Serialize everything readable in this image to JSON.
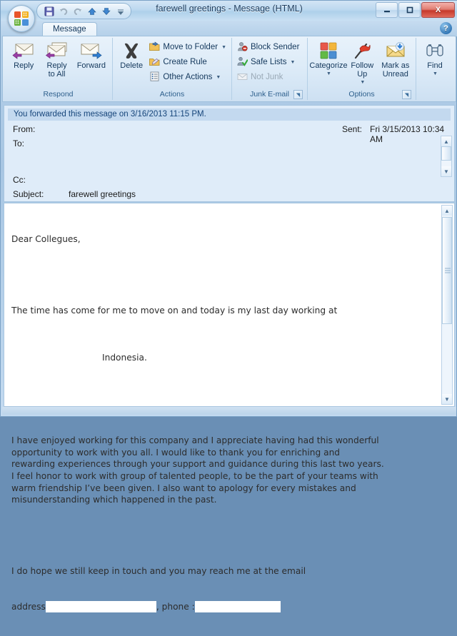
{
  "window": {
    "title": "farewell greetings  - Message (HTML)",
    "minimize_label": "–",
    "maximize_label": "□",
    "close_label": "X"
  },
  "quick_access": {
    "save_icon": "save-icon",
    "undo_icon": "undo-icon",
    "redo_icon": "redo-icon",
    "previous_icon": "previous-item-icon",
    "next_icon": "next-item-icon",
    "customize_icon": "customize-quick-access-icon"
  },
  "tabs": [
    {
      "label": "Message",
      "selected": true
    }
  ],
  "help": {
    "label": "?"
  },
  "ribbon": {
    "groups": [
      {
        "name": "Respond",
        "label": "Respond",
        "buttons": [
          {
            "label": "Reply",
            "icon": "reply-icon"
          },
          {
            "label": "Reply\nto All",
            "icon": "reply-all-icon"
          },
          {
            "label": "Forward",
            "icon": "forward-icon"
          }
        ]
      },
      {
        "name": "Actions",
        "label": "Actions",
        "big": {
          "label": "Delete",
          "icon": "delete-x-icon"
        },
        "items": [
          {
            "label": "Move to Folder",
            "icon": "move-to-folder-icon",
            "caret": true,
            "disabled": false
          },
          {
            "label": "Create Rule",
            "icon": "create-rule-icon",
            "caret": false,
            "disabled": false
          },
          {
            "label": "Other Actions",
            "icon": "other-actions-icon",
            "caret": true,
            "disabled": false
          }
        ]
      },
      {
        "name": "Junk E-mail",
        "label": "Junk E-mail",
        "items": [
          {
            "label": "Block Sender",
            "icon": "block-sender-icon",
            "caret": false,
            "disabled": false
          },
          {
            "label": "Safe Lists",
            "icon": "safe-lists-icon",
            "caret": true,
            "disabled": false
          },
          {
            "label": "Not Junk",
            "icon": "not-junk-icon",
            "caret": false,
            "disabled": true
          }
        ],
        "has_launcher": true
      },
      {
        "name": "Options",
        "label": "Options",
        "buttons": [
          {
            "label": "Categorize",
            "icon": "categorize-icon",
            "caret": true
          },
          {
            "label": "Follow\nUp",
            "icon": "follow-up-flag-icon",
            "caret": true
          },
          {
            "label": "Mark as\nUnread",
            "icon": "mark-as-unread-icon",
            "caret": false
          }
        ],
        "has_launcher": true
      },
      {
        "name": "Find",
        "label": "",
        "buttons": [
          {
            "label": "Find",
            "icon": "find-binoculars-icon",
            "caret": true
          }
        ]
      }
    ]
  },
  "message_header": {
    "info_bar": "You forwarded this message on 3/16/2013 11:15 PM.",
    "from_label": "From:",
    "from_value": "",
    "to_label": "To:",
    "to_value": "",
    "cc_label": "Cc:",
    "cc_value": "",
    "subject_label": "Subject:",
    "subject_value": "farewell greetings",
    "sent_label": "Sent:",
    "sent_value": "Fri 3/15/2013 10:34 AM"
  },
  "body": {
    "line_1": "Dear Collegues,",
    "line_2": "",
    "line_3": "The time has come for me to move on and today is my last day working at",
    "line_4_redacted_prefix": "                    ",
    "line_4": "Indonesia.",
    "line_5": "",
    "paragraph_2": "I have enjoyed working for this company and I appreciate having had this wonderful\nopportunity to work with you all. I would like to thank you for enriching and\nrewarding experiences through your support and guidance during this last two years.\nI feel honor to work with group of talented people, to be the part of your teams with\nwarm friendship I’ve been given. I also want to apology for every mistakes and\nmisunderstanding which happened in the past.",
    "paragraph_3_line_1": "I do hope we still keep in touch and you may reach me at the email",
    "paragraph_3_line_2_a": "address",
    "paragraph_3_line_2_b": ", phone :"
  },
  "colors": {
    "accent": "#2d5f8c",
    "titlebar": "#bcd8ef",
    "header_pane": "#dfecf9",
    "info_bar": "#c3d9ef",
    "close_button": "#c6392b"
  }
}
